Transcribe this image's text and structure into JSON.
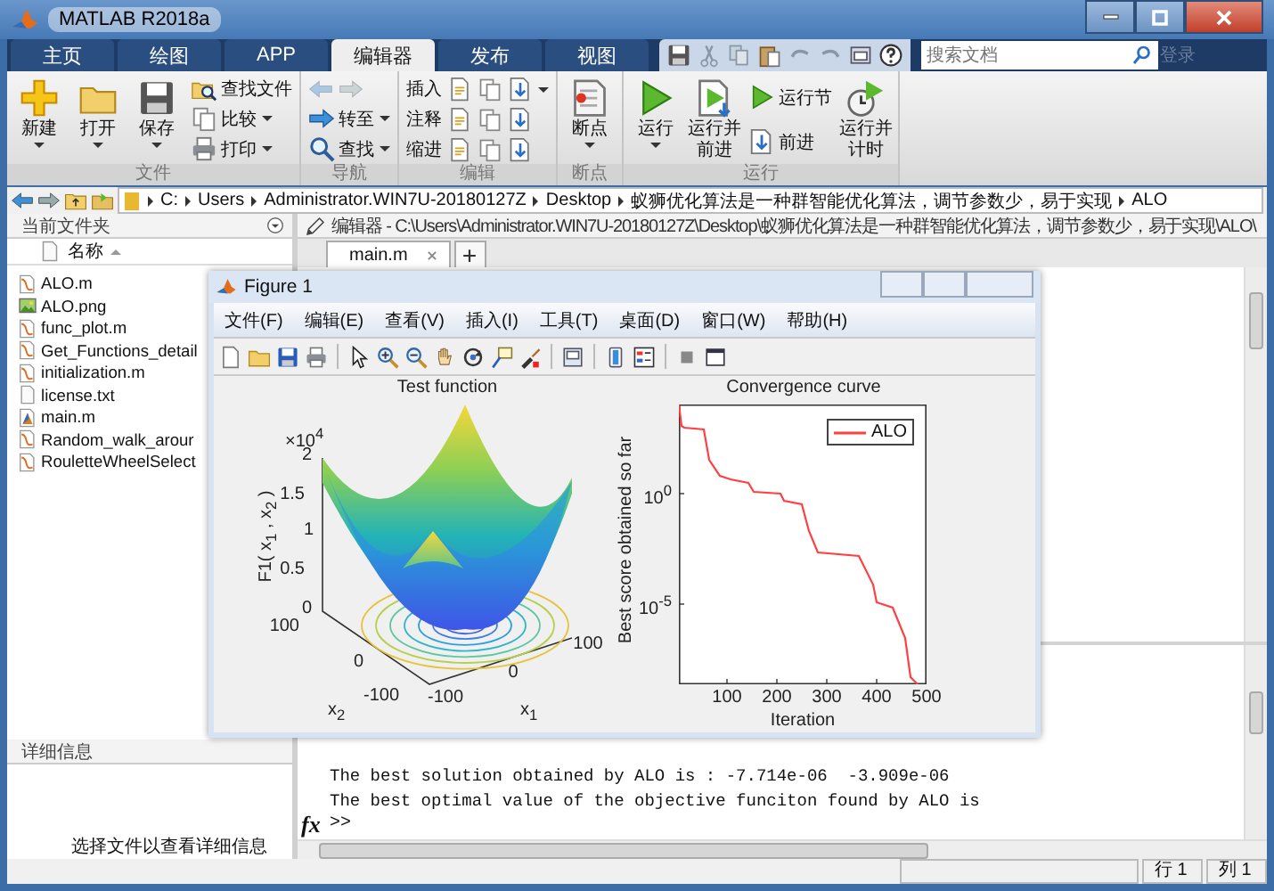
{
  "window": {
    "title": "MATLAB R2018a"
  },
  "tabs": [
    {
      "label": "主页",
      "selected": false
    },
    {
      "label": "绘图",
      "selected": false
    },
    {
      "label": "APP",
      "selected": false
    },
    {
      "label": "编辑器",
      "selected": true
    },
    {
      "label": "发布",
      "selected": false
    },
    {
      "label": "视图",
      "selected": false
    }
  ],
  "search": {
    "placeholder": "搜索文档"
  },
  "sign_in": {
    "label": "登录",
    "disabled": true
  },
  "ribbon": {
    "groups": [
      {
        "title": "文件",
        "buttons": [
          {
            "kind": "large",
            "label": "新建",
            "dropdown": true
          },
          {
            "kind": "large",
            "label": "打开",
            "dropdown": true
          },
          {
            "kind": "large",
            "label": "保存",
            "dropdown": true
          },
          {
            "kind": "small",
            "label": "查找文件",
            "dropdown": false
          },
          {
            "kind": "small",
            "label": "比较",
            "dropdown": true
          },
          {
            "kind": "small",
            "label": "打印",
            "dropdown": true
          }
        ]
      },
      {
        "title": "导航",
        "buttons": [
          {
            "kind": "arrows",
            "disabled": true
          },
          {
            "kind": "small",
            "label": "转至",
            "dropdown": true
          },
          {
            "kind": "small",
            "label": "查找",
            "dropdown": true
          }
        ]
      },
      {
        "title": "编辑",
        "buttons": [
          {
            "kind": "row",
            "label": "插入",
            "dropdown": true
          },
          {
            "kind": "row",
            "label": "注释",
            "dropdown": false
          },
          {
            "kind": "row",
            "label": "缩进",
            "dropdown": false
          }
        ]
      },
      {
        "title": "断点",
        "buttons": [
          {
            "kind": "large",
            "label": "断点",
            "dropdown": true
          }
        ]
      },
      {
        "title": "运行",
        "buttons": [
          {
            "kind": "large",
            "label": "运行",
            "dropdown": true
          },
          {
            "kind": "large",
            "label": "运行并前进",
            "dropdown": false
          },
          {
            "kind": "small",
            "label": "运行节",
            "dropdown": false
          },
          {
            "kind": "small",
            "label": "前进",
            "dropdown": false
          },
          {
            "kind": "large",
            "label": "运行并计时",
            "dropdown": false
          }
        ]
      }
    ]
  },
  "address_bar": {
    "path": [
      "C:",
      "Users",
      "Administrator.WIN7U-20180127Z",
      "Desktop",
      "蚁狮优化算法是一种群智能优化算法，调节参数少，易于实现",
      "ALO"
    ]
  },
  "current_folder": {
    "title": "当前文件夹",
    "column": "名称",
    "files": [
      {
        "name": "ALO.m",
        "kind": "function"
      },
      {
        "name": "ALO.png",
        "kind": "image"
      },
      {
        "name": "func_plot.m",
        "kind": "function"
      },
      {
        "name": "Get_Functions_detail",
        "kind": "function"
      },
      {
        "name": "initialization.m",
        "kind": "function"
      },
      {
        "name": "license.txt",
        "kind": "text"
      },
      {
        "name": "main.m",
        "kind": "script"
      },
      {
        "name": "Random_walk_arour",
        "kind": "function"
      },
      {
        "name": "RouletteWheelSelect",
        "kind": "function"
      }
    ]
  },
  "details": {
    "title": "详细信息",
    "message": "选择文件以查看详细信息"
  },
  "editor": {
    "title": "编辑器 - C:\\Users\\Administrator.WIN7U-20180127Z\\Desktop\\蚁狮优化算法是一种群智能优化算法，调节参数少，易于实现\\ALO\\",
    "tabs": [
      {
        "label": "main.m",
        "selected": true
      }
    ]
  },
  "command_window": {
    "lines": [
      "The best solution obtained by ALO is : -7.714e-06  -3.909e-06",
      "The best optimal value of the objective funciton found by ALO is"
    ],
    "fx": "fx",
    "prompt": ">>"
  },
  "status_bar": {
    "fields": [
      "行 1",
      "列 1"
    ]
  },
  "figure": {
    "title": "Figure 1",
    "menu": [
      "文件(F)",
      "编辑(E)",
      "查看(V)",
      "插入(I)",
      "工具(T)",
      "桌面(D)",
      "窗口(W)",
      "帮助(H)"
    ],
    "surface": {
      "title": "Test function",
      "exponent": "×10$^{4}$",
      "zticks": [
        "0",
        "0.5",
        "1",
        "1.5",
        "2"
      ],
      "zlabel": "F1( x$_{1}$ , x$_{2}$ )",
      "x2ticks": [
        "100",
        "0",
        "-100"
      ],
      "x2label": "x$_{2}$",
      "x1ticks": [
        "-100",
        "0",
        "100"
      ],
      "x1label": "x$_{1}$"
    },
    "convergence": {
      "title": "Convergence curve",
      "xlabel": "Iteration",
      "ylabel": "Best score obtained so far",
      "xticks": [
        "100",
        "200",
        "300",
        "400",
        "500"
      ],
      "yticks": [
        "10$^{0}$",
        "10$^{-5}$"
      ],
      "legend": "ALO"
    }
  }
}
